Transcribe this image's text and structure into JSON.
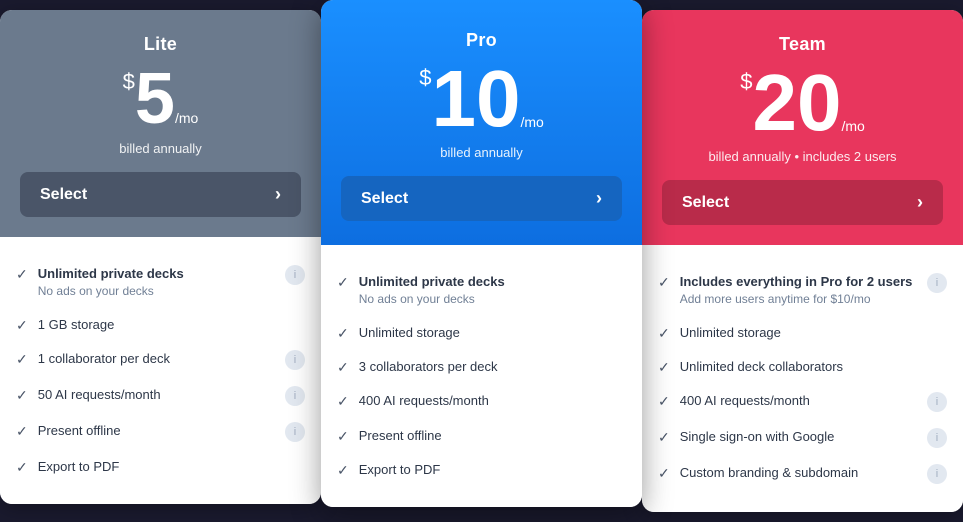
{
  "plans": [
    {
      "id": "lite",
      "name": "Lite",
      "price": "5",
      "period": "/mo",
      "billing": "billed annually",
      "select_label": "Select",
      "header_class": "lite-header",
      "btn_class": "lite-btn",
      "card_class": "lite",
      "features": [
        {
          "bold": "Unlimited private decks",
          "sub": "No ads on your decks",
          "info": true
        },
        {
          "text": "1 GB storage",
          "info": false
        },
        {
          "text": "1 collaborator per deck",
          "info": true
        },
        {
          "text": "50 AI requests/month",
          "info": true
        },
        {
          "text": "Present offline",
          "info": true
        },
        {
          "text": "Export to PDF",
          "info": false
        }
      ]
    },
    {
      "id": "pro",
      "name": "Pro",
      "price": "10",
      "period": "/mo",
      "billing": "billed annually",
      "select_label": "Select",
      "header_class": "pro-header",
      "btn_class": "pro-btn",
      "card_class": "pro",
      "features": [
        {
          "bold": "Unlimited private decks",
          "sub": "No ads on your decks",
          "info": false
        },
        {
          "text": "Unlimited storage",
          "info": false
        },
        {
          "text": "3 collaborators per deck",
          "info": false
        },
        {
          "text": "400 AI requests/month",
          "info": false
        },
        {
          "text": "Present offline",
          "info": false
        },
        {
          "text": "Export to PDF",
          "info": false
        }
      ]
    },
    {
      "id": "team",
      "name": "Team",
      "price": "20",
      "period": "/mo",
      "billing": "billed annually • includes 2 users",
      "select_label": "Select",
      "header_class": "team-header",
      "btn_class": "team-btn",
      "card_class": "team",
      "features": [
        {
          "bold": "Includes everything in Pro for 2 users",
          "sub": "Add more users anytime for $10/mo",
          "info": true
        },
        {
          "text": "Unlimited storage",
          "info": false
        },
        {
          "text": "Unlimited deck collaborators",
          "info": false
        },
        {
          "text": "400 AI requests/month",
          "info": true
        },
        {
          "text": "Single sign-on with Google",
          "info": true
        },
        {
          "text": "Custom branding & subdomain",
          "info": true
        }
      ]
    }
  ]
}
